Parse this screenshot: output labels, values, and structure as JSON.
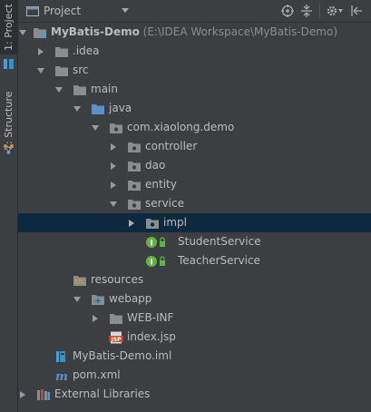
{
  "side_strip": {
    "project_tab_label": "1: Project",
    "structure_tab_label": "7: Structure"
  },
  "header": {
    "view_label": "Project",
    "icons": [
      "target-icon",
      "collapse-all-icon",
      "settings-icon",
      "hide-icon"
    ]
  },
  "tree": {
    "root": {
      "name": "MyBatis-Demo",
      "path": "(E:\\IDEA Workspace\\MyBatis-Demo)"
    },
    "idea": ".idea",
    "src": "src",
    "main": "main",
    "java": "java",
    "package": "com.xiaolong.demo",
    "controller": "controller",
    "dao": "dao",
    "entity": "entity",
    "service": "service",
    "impl": "impl",
    "student_service": "StudentService",
    "teacher_service": "TeacherService",
    "resources": "resources",
    "webapp": "webapp",
    "web_inf": "WEB-INF",
    "index_jsp": "index.jsp",
    "iml": "MyBatis-Demo.iml",
    "pom": "pom.xml",
    "external_libraries": "External Libraries"
  },
  "colors": {
    "background": "#3c3f41",
    "selection": "#0d293e",
    "text": "#bbbbbb",
    "folder": "#8c8c8c",
    "source_folder": "#5e92c6",
    "interface_green": "#62b543",
    "resources_folder": "#c09a4e"
  }
}
